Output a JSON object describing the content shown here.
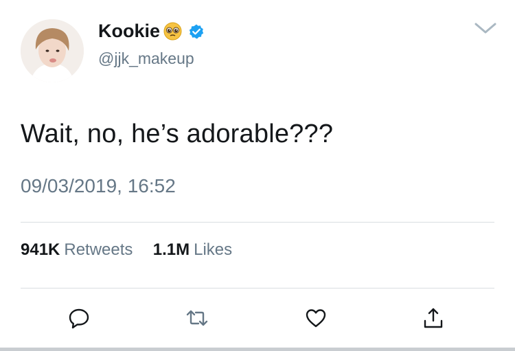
{
  "tweet": {
    "display_name": "Kookie",
    "handle": "@jjk_makeup",
    "text": "Wait, no, he’s adorable???",
    "timestamp": "09/03/2019, 16:52"
  },
  "stats": {
    "retweets_value": "941K",
    "retweets_label": "Retweets",
    "likes_value": "1.1M",
    "likes_label": "Likes"
  },
  "icons": {
    "name_emoji": "pleading-face-icon",
    "verified": "verified-badge-icon",
    "menu": "chevron-down-icon",
    "reply": "reply-icon",
    "retweet": "retweet-icon",
    "like": "heart-icon",
    "share": "share-icon"
  },
  "colors": {
    "text_primary": "#14171a",
    "text_secondary": "#657786",
    "verified_blue": "#1da1f2",
    "divider": "#d8dde1"
  }
}
